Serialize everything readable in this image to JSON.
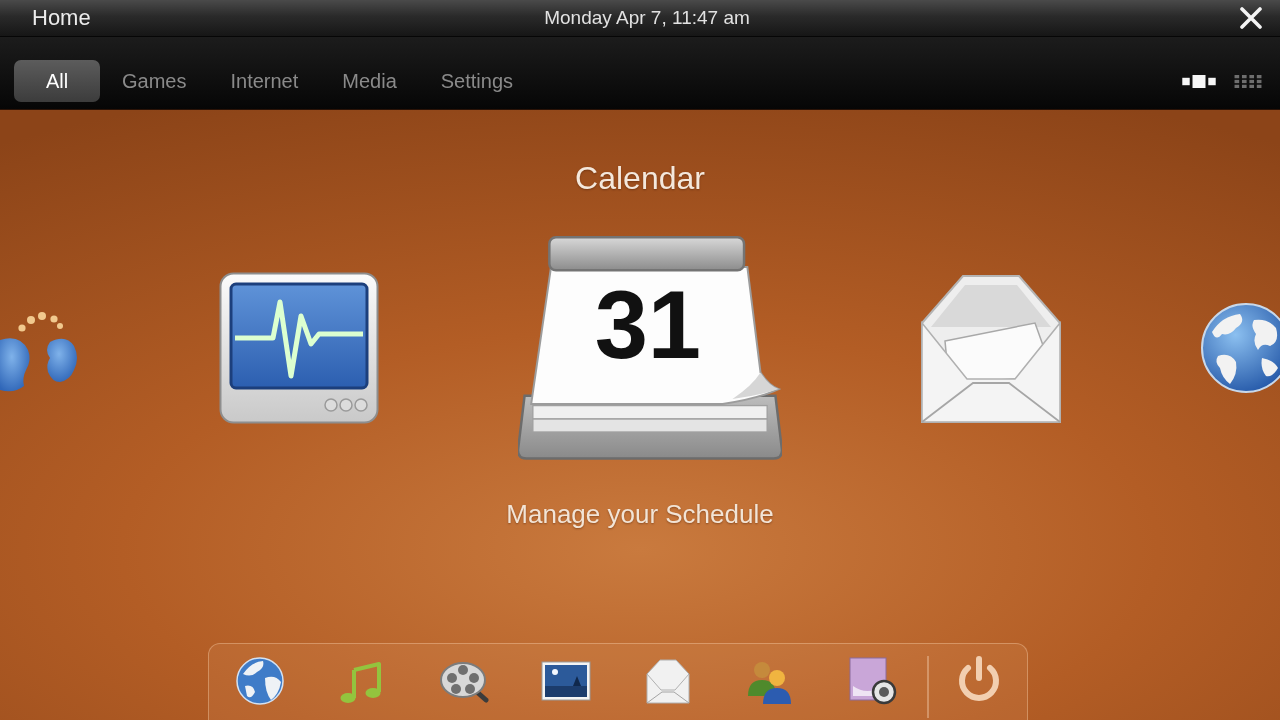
{
  "top_bar": {
    "title": "Home",
    "datetime": "Monday Apr 7, 11:47 am"
  },
  "tabs": [
    {
      "label": "All",
      "selected": true
    },
    {
      "label": "Games",
      "selected": false
    },
    {
      "label": "Internet",
      "selected": false
    },
    {
      "label": "Media",
      "selected": false
    },
    {
      "label": "Settings",
      "selected": false
    }
  ],
  "view_modes": [
    {
      "kind": "carousel",
      "selected": true
    },
    {
      "kind": "grid",
      "selected": false
    }
  ],
  "carousel": {
    "title": "Calendar",
    "description": "Manage your Schedule",
    "items": [
      {
        "kind": "people",
        "selected": false
      },
      {
        "kind": "monitor",
        "selected": false
      },
      {
        "kind": "calendar",
        "selected": true,
        "day": "31"
      },
      {
        "kind": "mail",
        "selected": false
      },
      {
        "kind": "globe",
        "selected": false
      }
    ]
  },
  "dock": {
    "items": [
      {
        "kind": "globe"
      },
      {
        "kind": "music"
      },
      {
        "kind": "film"
      },
      {
        "kind": "photo"
      },
      {
        "kind": "mail"
      },
      {
        "kind": "contacts"
      },
      {
        "kind": "webcam"
      },
      {
        "kind": "power"
      }
    ]
  }
}
